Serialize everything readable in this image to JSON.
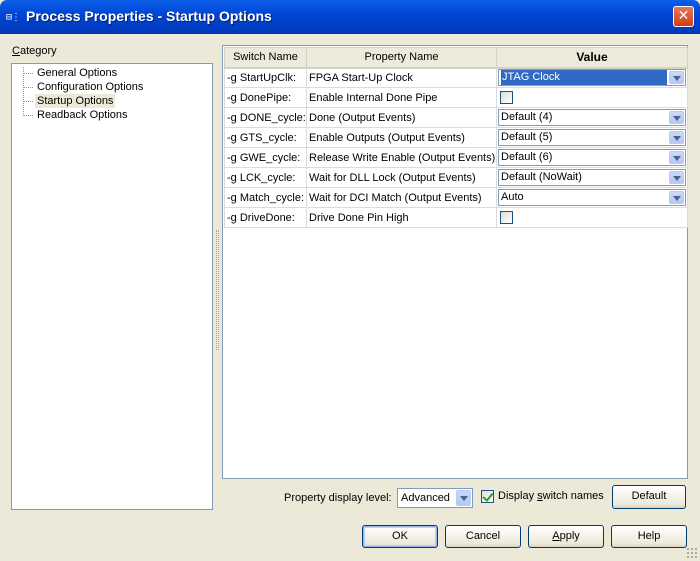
{
  "window": {
    "title": "Process Properties - Startup Options",
    "icon_glyph": "⊟⋮",
    "close_glyph": "✕"
  },
  "category": {
    "label_first": "C",
    "label_rest": "ategory",
    "items": [
      {
        "label": "General Options",
        "selected": false
      },
      {
        "label": "Configuration Options",
        "selected": false
      },
      {
        "label": "Startup Options",
        "selected": true
      },
      {
        "label": "Readback Options",
        "selected": false
      }
    ]
  },
  "grid": {
    "headers": {
      "switch": "Switch Name",
      "property": "Property Name",
      "value": "Value"
    },
    "rows": [
      {
        "switch": "-g StartUpClk:",
        "property": "FPGA Start-Up Clock",
        "type": "dropdown",
        "value": "JTAG Clock",
        "selected": true
      },
      {
        "switch": "-g DonePipe:",
        "property": "Enable Internal Done Pipe",
        "type": "checkbox",
        "checked": false
      },
      {
        "switch": "-g DONE_cycle:",
        "property": "Done (Output Events)",
        "type": "dropdown",
        "value": "Default (4)"
      },
      {
        "switch": "-g GTS_cycle:",
        "property": "Enable Outputs (Output Events)",
        "type": "dropdown",
        "value": "Default (5)"
      },
      {
        "switch": "-g GWE_cycle:",
        "property": "Release Write Enable (Output Events)",
        "type": "dropdown",
        "value": "Default (6)"
      },
      {
        "switch": "-g LCK_cycle:",
        "property": "Wait for DLL Lock (Output Events)",
        "type": "dropdown",
        "value": "Default (NoWait)"
      },
      {
        "switch": "-g Match_cycle:",
        "property": "Wait for DCI Match (Output Events)",
        "type": "dropdown",
        "value": "Auto"
      },
      {
        "switch": "-g DriveDone:",
        "property": "Drive Done Pin High",
        "type": "checkbox",
        "checked": false
      }
    ]
  },
  "footer": {
    "display_level_label": "Property display level:",
    "display_level_value": "Advanced",
    "display_switch_names": {
      "label_pre": "Display ",
      "label_u": "s",
      "label_post": "witch names",
      "checked": true
    },
    "default_button": "Default"
  },
  "buttons": {
    "ok": "OK",
    "cancel": "Cancel",
    "apply_u": "A",
    "apply_rest": "pply",
    "help": "Help"
  },
  "colors": {
    "titlebar": "#0046d5",
    "dialog_bg": "#ece9d8",
    "selection": "#316ac5"
  }
}
